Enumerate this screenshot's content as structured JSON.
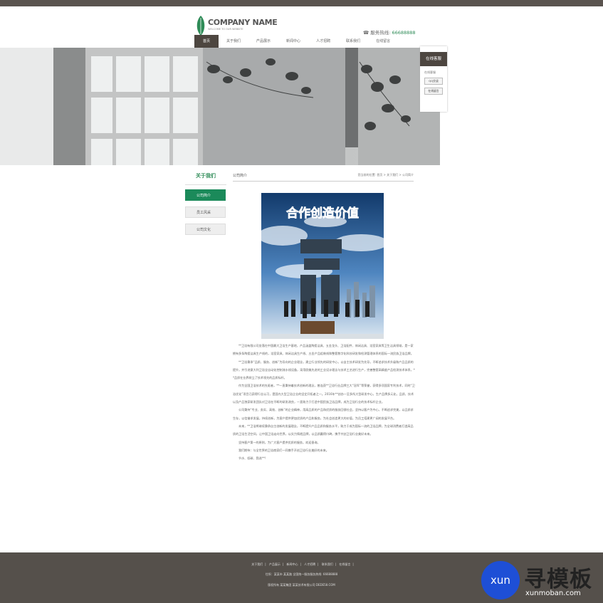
{
  "header": {
    "company_name": "COMPANY NAME",
    "tagline": "WELCOME TO OUR WEBSITE",
    "hotline_label": "服务热线:",
    "hotline_number": "66688888"
  },
  "nav": [
    "首页",
    "关于我们",
    "产品展示",
    "新闻中心",
    "人才招聘",
    "联系我们",
    "在线留言"
  ],
  "online_service": {
    "title": "在线客服",
    "label": "在线客服",
    "qq_button": "QQ交谈",
    "msg_button": "在线留言"
  },
  "sidebar": {
    "title": "关于我们",
    "items": [
      "公司简介",
      "员工风采",
      "公司文化"
    ]
  },
  "content": {
    "title": "公司简介",
    "breadcrumb": "您当前的位置: 首页 > 关于我们 > 公司简介",
    "image_text": "合作创造价值",
    "paragraphs": [
      "**卫浴有限公司坐落在中国最大卫浴生产基地，产品涵盖陶瓷洁具、五金龙头、卫浴配件、休闲洁具、浴室家具等卫生洁具领域，是一家拥有多条陶瓷洁具生产线的，浴室家具、休闲洁具生产线、五金产品组装线和整套数字化科技研发和检测管理体系的国际一流民族卫浴品牌。",
      "**卫浴秉承“品质、服务、创新”为导向的企业理念，建立行业领先的研发中心，以自主技术研发为先导，不断追求技术升级和产品品质的提升，并引进意大利卫浴全自动化控制流水线设备，采用欧美先进的工业设计理念与技术工艺进行生产，完善整套高精度产品检测技术体系，**品质在业界树立了技术领先的品质标杆。",
      "作为全国卫浴技术的先驱者，**一直秉持着技术创新的理念，曾连获**卫浴行业品牌三大“冠军”等荣誉，获得多项国家专利技术，同时“卫浴优化”项目已获得行业认可，是国内大型卫浴企业的坚定开拓者之一。2016年**创办一至多所大型研发中心，生产品牌多元化，品质、技术以及产品独家研发团队对卫浴在不断的研发改良，一直致力于打造中国民族卫浴品牌，成为卫浴行业的技术标杆企业。",
      "公司秉持“专业、务实、高效、创新”的企业精神，用高品质的产品和优质的服务回馈社会，坚持以客户为中心，不断追求完美，以品质求生存，以信誉求发展，持续创新，为客户提供更加优质的产品和服务，为社会创造更大的价值，为员工搭建更广阔的发展平台。",
      "未来，**卫浴将继续秉承自主创新的发展理念，不断提升产品品质和服务水平，致力于成为国际一流的卫浴品牌，为全球消费者打造高品质的卫浴生活空间，让中国卫浴走向世界，以实力铸就品牌，以品质赢得口碑，携手共创卫浴行业美好未来。",
      "坚持客户第一的原则，为广大客户提供优质的服务，欢迎垂询。",
      "我们期待：与全世界的卫浴商家们一同携手开创卫浴行业美好的未来。",
      "节水、低碳、我选**!"
    ]
  },
  "footer": {
    "links": [
      "关于我们",
      "产品展示",
      "新闻中心",
      "人才招聘",
      "联系我们",
      "在线留言"
    ],
    "info": "住所：某某市 某某路  全国统一服务服务热线: 66688888",
    "copyright": "版权所有 某某集团 某某技术有限公司 DEDE58.COM"
  },
  "watermark": {
    "circle_text": "xun",
    "brand": "寻模板",
    "url": "xunmoban.com"
  }
}
